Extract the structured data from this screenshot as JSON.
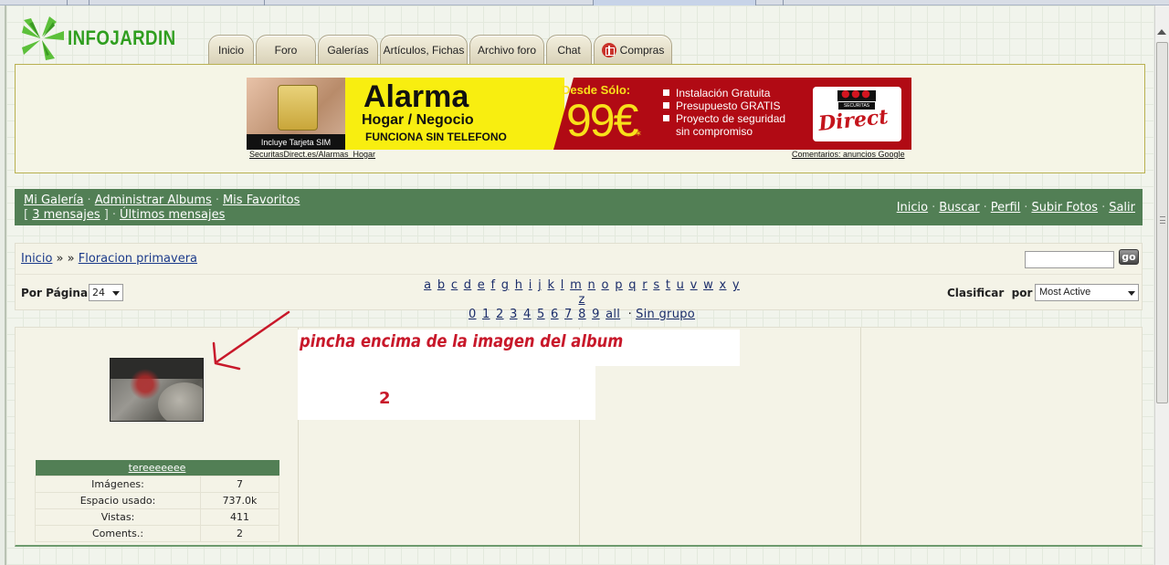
{
  "brand": {
    "logo_text": "INFOJARDIN"
  },
  "nav": {
    "tabs": [
      {
        "label": "Inicio"
      },
      {
        "label": "Foro"
      },
      {
        "label": "Galerías"
      },
      {
        "label": "Artículos, Fichas"
      },
      {
        "label": "Archivo foro"
      },
      {
        "label": "Chat"
      },
      {
        "label": "Compras"
      }
    ]
  },
  "ad": {
    "sim_caption": "Incluye Tarjeta SIM",
    "headline": "Alarma",
    "subheadline": "Hogar / Negocio",
    "tagline": "FUNCIONA SIN TELEFONO",
    "from_label": "Desde Sólo:",
    "price": "99€",
    "price_mark": "*",
    "bullets": [
      "Instalación Gratuita",
      "Presupuesto GRATIS",
      "Proyecto de seguridad",
      "sin compromiso"
    ],
    "logo_small": "SECURITAS",
    "logo_big": "Direct",
    "link_left": "SecuritasDirect.es/Alarmas_Hogar",
    "link_right": "Comentarios: anuncios Google"
  },
  "userbar": {
    "left": {
      "my_gallery": "Mi Galería",
      "manage_albums": "Administrar Albums",
      "favorites": "Mis Favoritos",
      "messages": "3 mensajes",
      "latest_messages": "Últimos mensajes",
      "bracket_open": "[",
      "bracket_close": "]"
    },
    "right": [
      "Inicio",
      "Buscar",
      "Perfil",
      "Subir Fotos",
      "Salir"
    ],
    "separator": "·"
  },
  "breadcrumb": {
    "home": "Inicio",
    "sep": "» »",
    "current": "Floracion primavera"
  },
  "search": {
    "value": "",
    "button": "go"
  },
  "filter": {
    "per_page_label": "Por Página",
    "per_page_value": "24",
    "letters": [
      "a",
      "b",
      "c",
      "d",
      "e",
      "f",
      "g",
      "h",
      "i",
      "j",
      "k",
      "l",
      "m",
      "n",
      "o",
      "p",
      "q",
      "r",
      "s",
      "t",
      "u",
      "v",
      "w",
      "x",
      "y",
      "z"
    ],
    "digits": [
      "0",
      "1",
      "2",
      "3",
      "4",
      "5",
      "6",
      "7",
      "8",
      "9",
      "all"
    ],
    "no_group": "Sin grupo",
    "sort_label": "Clasificar  por",
    "sort_value": "Most Active"
  },
  "album": {
    "owner": "tereeeeeee",
    "stats": [
      {
        "k": "Imágenes:",
        "v": "7"
      },
      {
        "k": "Espacio usado:",
        "v": "737.0k"
      },
      {
        "k": "Vistas:",
        "v": "411"
      },
      {
        "k": "Coments.:",
        "v": "2"
      }
    ]
  },
  "annotation": {
    "text": "pincha encima de la imagen del album",
    "number": "2",
    "color": "#c8182a"
  }
}
